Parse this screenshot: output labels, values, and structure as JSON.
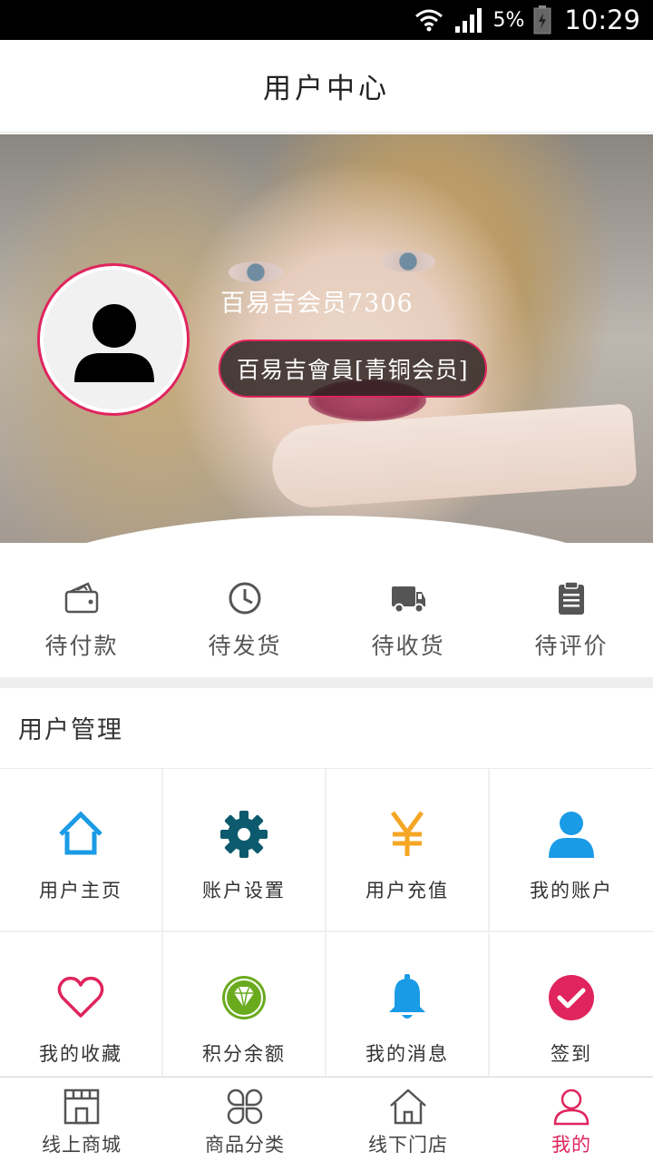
{
  "status_bar": {
    "battery": "5%",
    "time": "10:29"
  },
  "header": {
    "title": "用户中心"
  },
  "profile": {
    "username": "百易吉会员7306",
    "level": "百易吉會員[青铜会员]"
  },
  "orders": [
    {
      "label": "待付款",
      "icon": "wallet-icon"
    },
    {
      "label": "待发货",
      "icon": "clock-icon"
    },
    {
      "label": "待收货",
      "icon": "truck-icon"
    },
    {
      "label": "待评价",
      "icon": "clipboard-icon"
    }
  ],
  "user_management": {
    "title": "用户管理",
    "items": [
      {
        "label": "用户主页",
        "icon": "home-icon",
        "color": "#1a9be6"
      },
      {
        "label": "账户设置",
        "icon": "gear-icon",
        "color": "#0d5a6e"
      },
      {
        "label": "用户充值",
        "icon": "yen-icon",
        "color": "#f5a623"
      },
      {
        "label": "我的账户",
        "icon": "user-icon",
        "color": "#1a9be6"
      },
      {
        "label": "我的收藏",
        "icon": "heart-icon",
        "color": "#e0245e"
      },
      {
        "label": "积分余额",
        "icon": "diamond-icon",
        "color": "#6aab1e"
      },
      {
        "label": "我的消息",
        "icon": "bell-icon",
        "color": "#1a9be6"
      },
      {
        "label": "签到",
        "icon": "check-icon",
        "color": "#e0245e"
      }
    ]
  },
  "tabbar": {
    "items": [
      {
        "label": "线上商城",
        "icon": "store-icon"
      },
      {
        "label": "商品分类",
        "icon": "category-icon"
      },
      {
        "label": "线下门店",
        "icon": "house-icon"
      },
      {
        "label": "我的",
        "icon": "person-icon",
        "active": true
      }
    ]
  },
  "colors": {
    "accent": "#e0245e",
    "text": "#333333"
  }
}
